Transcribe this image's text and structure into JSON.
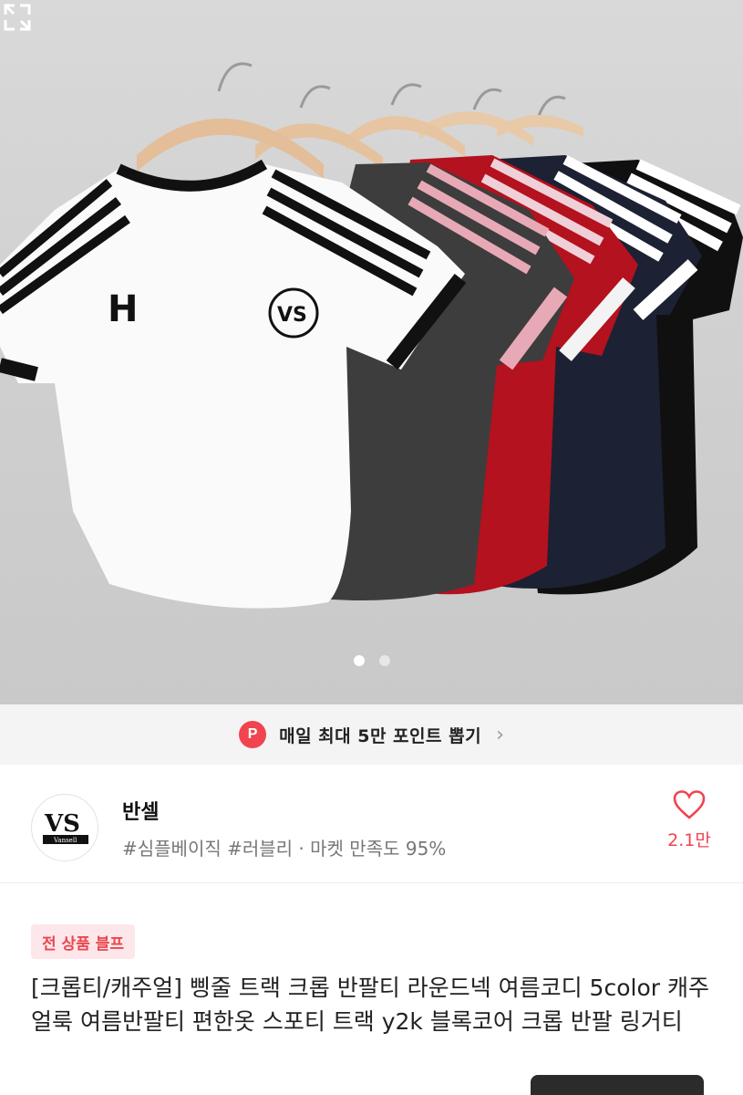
{
  "hero": {
    "image_alt": "",
    "hanger_brand": "Vansell",
    "logo_mark": "H",
    "print_mark": "VS",
    "page_dots": 2,
    "active_dot": 1,
    "expand_icon": "expand-icon"
  },
  "banner": {
    "badge": "P",
    "text": "매일 최대 5만 포인트 뽑기",
    "chevron": "›"
  },
  "shop": {
    "logo_text": "VS",
    "logo_subtext": "Vansell",
    "name": "반셀",
    "tags": "#심플베이직 #러블리 · 마켓 만족도 95%",
    "like_count": "2.1만"
  },
  "product": {
    "badge": "전 상품 블프",
    "title": "[크롭티/캐주얼] 삥줄 트랙 크롭 반팔티 라운드넥 여름코디 5color 캐주얼룩 여름반팔티 편한옷 스포티 트랙 y2k 블록코어 크롭 반팔 링거티"
  },
  "colors": {
    "accent": "#f0444e",
    "badge_bg": "#fde7ea",
    "tshirts": [
      "#101010",
      "#1c2133",
      "#b3121e",
      "#3d3d3d",
      "#ffffff"
    ]
  }
}
